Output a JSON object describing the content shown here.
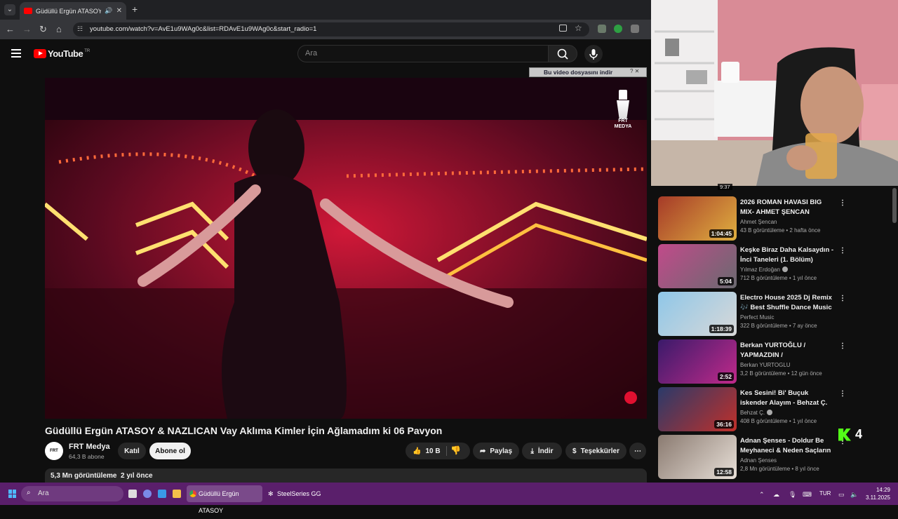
{
  "browser": {
    "tab_title": "Güdüllü Ergün ATASOY & N",
    "address": "youtube.com/watch?v=AvE1u9WAg0c&list=RDAvE1u9WAg0c&start_radio=1"
  },
  "youtube": {
    "logo": "YouTube",
    "region": "TR",
    "search_placeholder": "Ara",
    "downloader_label": "Bu video dosyasını indir"
  },
  "video": {
    "title": "Güdüllü Ergün ATASOY & NAZLICAN Vay Aklıma Kimler İçin Ağlamadım ki 06 Pavyon",
    "watermark": "FRT MEDYA",
    "channel": {
      "avatar_text": "FRT",
      "name": "FRT Medya",
      "subscribers": "64,3 B abone"
    },
    "join_label": "Katıl",
    "subscribe_label": "Abone ol",
    "likes": "10 B",
    "share_label": "Paylaş",
    "download_label": "İndir",
    "thanks_label": "Teşekkürler",
    "views": "5,3 Mn görüntüleme",
    "age": "2 yıl önce"
  },
  "sidebar": {
    "prev_duration": "9:37",
    "items": [
      {
        "title": "2026 ROMAN HAVASI BIG MIX- AHMET ŞENCAN",
        "channel": "Ahmet Şencan",
        "verified": false,
        "views": "43 B görüntüleme",
        "age": "2 hafta önce",
        "duration": "1:04:45",
        "thumb_colors": [
          "#a63a28",
          "#e0b040"
        ]
      },
      {
        "title": "Keşke Biraz Daha Kalsaydın - İnci Taneleri (1. Bölüm)",
        "channel": "Yılmaz Erdoğan",
        "verified": true,
        "views": "712 B görüntüleme",
        "age": "1 yıl önce",
        "duration": "5:04",
        "thumb_colors": [
          "#c14a8a",
          "#6a6a70"
        ]
      },
      {
        "title": "Electro House 2025 Dj Remix 🎶 Best Shuffle Dance Music ...",
        "channel": "Perfect Music",
        "verified": false,
        "views": "322 B görüntüleme",
        "age": "7 ay önce",
        "duration": "1:18:39",
        "thumb_colors": [
          "#8fc7e8",
          "#d8d8d8"
        ]
      },
      {
        "title": "Berkan YURTOĞLU / YAPMAZDIN /",
        "channel": "Berkan YURTOGLU",
        "verified": false,
        "views": "3,2 B görüntüleme",
        "age": "12 gün önce",
        "duration": "2:52",
        "thumb_colors": [
          "#3a1a6a",
          "#c02a8a"
        ]
      },
      {
        "title": "Kes Sesini! Bi' Buçuk iskender Alayım - Behzat Ç.",
        "channel": "Behzat Ç.",
        "verified": true,
        "views": "408 B görüntüleme",
        "age": "1 yıl önce",
        "duration": "36:16",
        "thumb_colors": [
          "#2a3a6a",
          "#c0302a"
        ]
      },
      {
        "title": "Adnan Şenses - Doldur Be Meyhaneci & Neden Saçların ...",
        "channel": "Adnan Şenses",
        "verified": false,
        "views": "2,8 Mn görüntüleme",
        "age": "8 yıl önce",
        "duration": "12:58",
        "thumb_colors": [
          "#8a7a70",
          "#e8e0d8"
        ]
      }
    ]
  },
  "overlay": {
    "kick_viewers": "4"
  },
  "taskbar": {
    "search_placeholder": "Ara",
    "chrome_label": "Güdüllü Ergün ATASOY",
    "steelseries_label": "SteelSeries GG",
    "language": "TUR",
    "time": "14:29",
    "date": "3.11.2025"
  }
}
